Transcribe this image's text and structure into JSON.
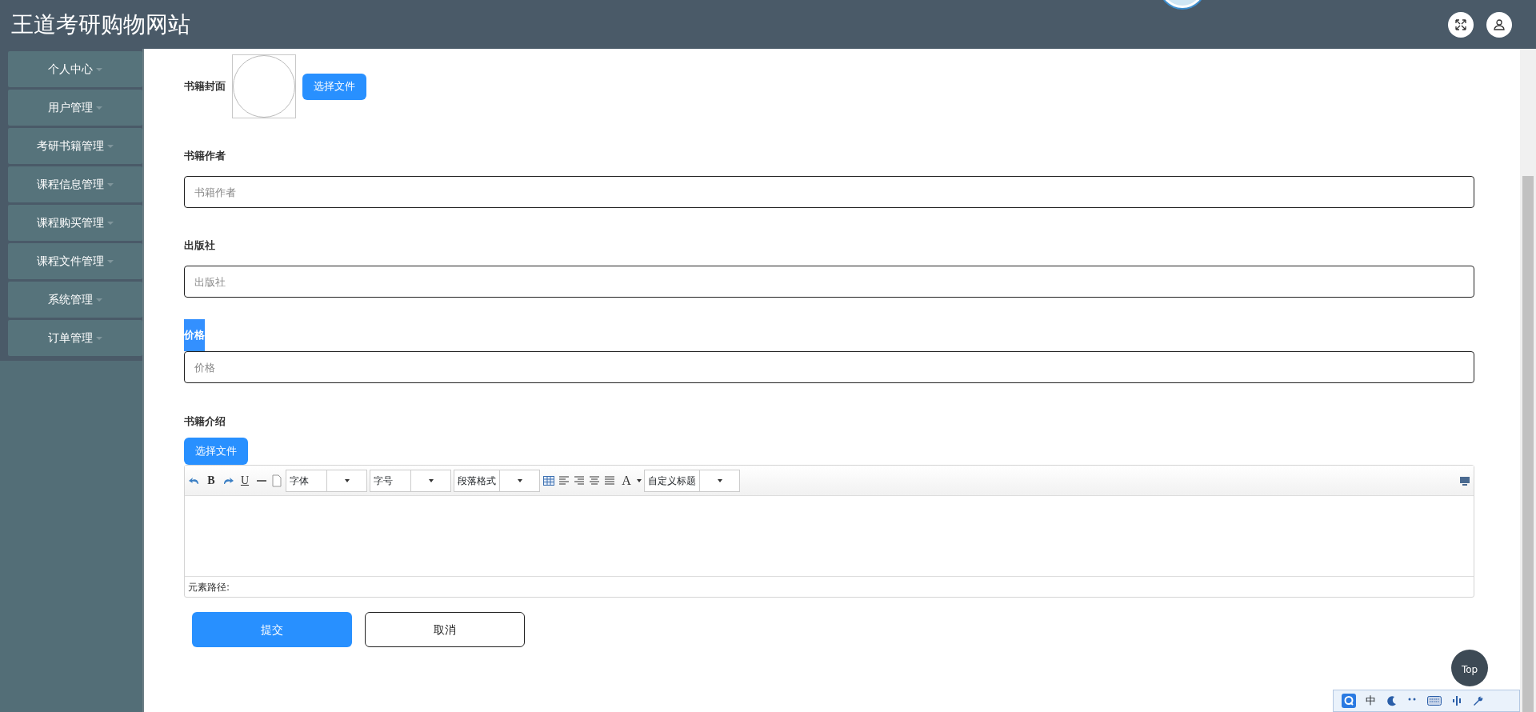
{
  "header": {
    "title": "王道考研购物网站"
  },
  "sidebar": {
    "items": [
      {
        "label": "个人中心"
      },
      {
        "label": "用户管理"
      },
      {
        "label": "考研书籍管理"
      },
      {
        "label": "课程信息管理"
      },
      {
        "label": "课程购买管理"
      },
      {
        "label": "课程文件管理"
      },
      {
        "label": "系统管理"
      },
      {
        "label": "订单管理"
      }
    ]
  },
  "form": {
    "fields": [
      {
        "kind": "image",
        "label": "书籍封面",
        "highlighted": false,
        "button": "选择文件"
      },
      {
        "kind": "text",
        "label": "书籍作者",
        "highlighted": false,
        "placeholder": "书籍作者"
      },
      {
        "kind": "text",
        "label": "出版社",
        "highlighted": false,
        "placeholder": "出版社"
      },
      {
        "kind": "text",
        "label": "价格",
        "highlighted": true,
        "placeholder": "价格"
      },
      {
        "kind": "editor",
        "label": "书籍介绍",
        "highlighted": false,
        "button": "选择文件",
        "toolbar": [
          {
            "kind": "undo"
          },
          {
            "kind": "bold",
            "text": "B"
          },
          {
            "kind": "redo"
          },
          {
            "kind": "underline",
            "text": "U"
          },
          {
            "kind": "hr"
          },
          {
            "kind": "page"
          },
          {
            "kind": "select",
            "text": "字体"
          },
          {
            "kind": "select",
            "text": "字号"
          },
          {
            "kind": "select",
            "text": "段落格式"
          },
          {
            "kind": "table"
          },
          {
            "kind": "align-left"
          },
          {
            "kind": "align-right"
          },
          {
            "kind": "align-center"
          },
          {
            "kind": "justify"
          },
          {
            "kind": "font-color",
            "text": "A"
          },
          {
            "kind": "select",
            "text": "自定义标题"
          }
        ],
        "path_label": "元素路径:"
      }
    ],
    "buttons": [
      {
        "kind": "primary",
        "label": "提交"
      },
      {
        "kind": "outline",
        "label": "取消"
      }
    ]
  },
  "top_button": "Top",
  "ime_bar": {
    "mode": "中"
  }
}
